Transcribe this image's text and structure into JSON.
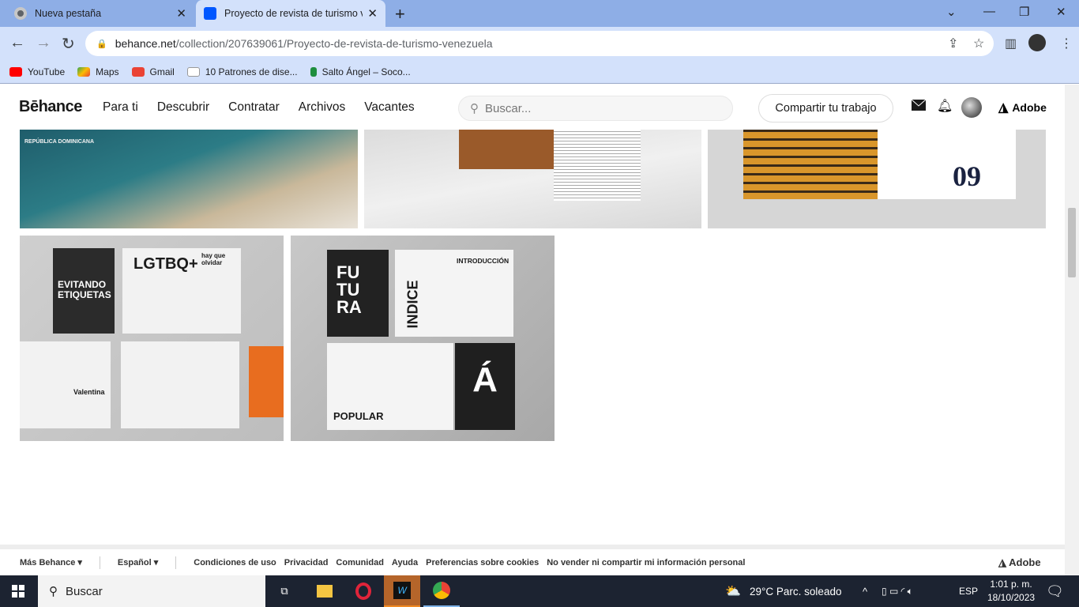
{
  "browser": {
    "tabs": [
      {
        "label": "Nueva pestaña"
      },
      {
        "label": "Proyecto de revista de turismo v"
      }
    ],
    "url_host": "behance.net",
    "url_path": "/collection/207639061/Proyecto-de-revista-de-turismo-venezuela",
    "bookmarks": [
      {
        "label": "YouTube",
        "color": "#ff0000"
      },
      {
        "label": "Maps",
        "color": "#34a853"
      },
      {
        "label": "Gmail",
        "color": "#ea4335"
      },
      {
        "label": "10 Patrones de dise...",
        "color": "#ffffff"
      },
      {
        "label": "Salto Ángel – Soco...",
        "color": "#1e8e3e"
      }
    ]
  },
  "header": {
    "logo": "Bēhance",
    "nav": [
      "Para ti",
      "Descubrir",
      "Contratar",
      "Archivos",
      "Vacantes"
    ],
    "search_placeholder": "Buscar...",
    "share_label": "Compartir tu trabajo",
    "adobe_label": "Adobe"
  },
  "tiles": {
    "lettering": [
      "REPÚBLICA DOMINICANA",
      "09",
      "EVITANDO ETIQUETAS",
      "LGTBQ+",
      "hay que olvidar",
      "Valentina",
      "FUTURA",
      "INDICE",
      "INTRODUCCIÓN",
      "POPULAR",
      "Á"
    ]
  },
  "footer": {
    "more": "Más Behance ▾",
    "language": "Español ▾",
    "links": [
      "Condiciones de uso",
      "Privacidad",
      "Comunidad",
      "Ayuda",
      "Preferencias sobre cookies",
      "No vender ni compartir mi información personal"
    ],
    "adobe": "Adobe"
  },
  "taskbar": {
    "search": "Buscar",
    "weather": "29°C  Parc. soleado",
    "lang": "ESP",
    "time": "1:01 p. m.",
    "date": "18/10/2023"
  }
}
